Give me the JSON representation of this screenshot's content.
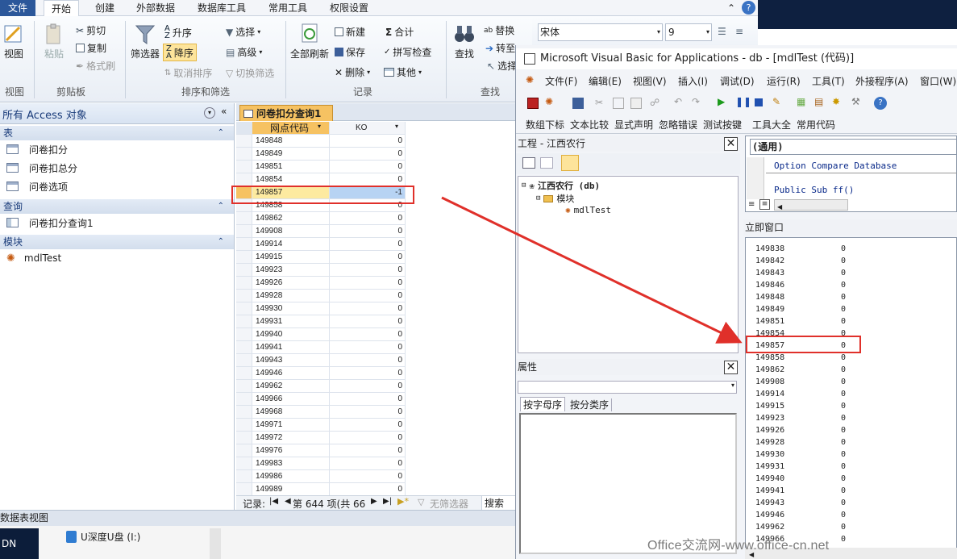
{
  "ribbon_tabs": [
    "文件",
    "开始",
    "创建",
    "外部数据",
    "数据库工具",
    "常用工具",
    "权限设置"
  ],
  "ribbon": {
    "view": "视图",
    "paste": "粘贴",
    "cut": "剪切",
    "copy": "复制",
    "format_painter": "格式刷",
    "filter": "筛选器",
    "asc": "升序",
    "desc": "降序",
    "clear_sort": "取消排序",
    "selection": "选择",
    "advanced": "高级",
    "toggle_filter": "切换筛选",
    "refresh_all": "全部刷新",
    "new": "新建",
    "save": "保存",
    "delete": "删除",
    "totals": "合计",
    "spelling": "拼写检查",
    "more": "其他",
    "find": "查找",
    "replace": "替换",
    "goto": "转至",
    "select": "选择",
    "groups": [
      "视图",
      "剪贴板",
      "排序和筛选",
      "记录",
      "查找"
    ]
  },
  "font": {
    "name": "宋体",
    "size": "9"
  },
  "nav": {
    "title": "所有 Access 对象",
    "tables_hdr": "表",
    "tables": [
      "问卷扣分",
      "问卷扣总分",
      "问卷选项"
    ],
    "queries_hdr": "查询",
    "queries": [
      "问卷扣分查询1"
    ],
    "modules_hdr": "模块",
    "modules": [
      "mdlTest"
    ]
  },
  "datasheet": {
    "tab": "问卷扣分查询1",
    "col1": "网点代码",
    "col2": "KO",
    "rows": [
      [
        "149848",
        "0"
      ],
      [
        "149849",
        "0"
      ],
      [
        "149851",
        "0"
      ],
      [
        "149854",
        "0"
      ],
      [
        "149857",
        "-1"
      ],
      [
        "149858",
        "0"
      ],
      [
        "149862",
        "0"
      ],
      [
        "149908",
        "0"
      ],
      [
        "149914",
        "0"
      ],
      [
        "149915",
        "0"
      ],
      [
        "149923",
        "0"
      ],
      [
        "149926",
        "0"
      ],
      [
        "149928",
        "0"
      ],
      [
        "149930",
        "0"
      ],
      [
        "149931",
        "0"
      ],
      [
        "149940",
        "0"
      ],
      [
        "149941",
        "0"
      ],
      [
        "149943",
        "0"
      ],
      [
        "149946",
        "0"
      ],
      [
        "149962",
        "0"
      ],
      [
        "149966",
        "0"
      ],
      [
        "149968",
        "0"
      ],
      [
        "149971",
        "0"
      ],
      [
        "149972",
        "0"
      ],
      [
        "149976",
        "0"
      ],
      [
        "149983",
        "0"
      ],
      [
        "149986",
        "0"
      ],
      [
        "149989",
        "0"
      ]
    ],
    "selected_index": 4,
    "record_label": "记录:",
    "record_pos": "第 644 项(共 66",
    "no_filter": "无筛选器",
    "search": "搜索"
  },
  "status": {
    "text": "数据表视图"
  },
  "taskbar": {
    "left": "DN",
    "drive": "U深度U盘 (I:)"
  },
  "vba": {
    "title": "Microsoft Visual Basic for Applications - db - [mdlTest (代码)]",
    "menus": [
      "文件(F)",
      "编辑(E)",
      "视图(V)",
      "插入(I)",
      "调试(D)",
      "运行(R)",
      "工具(T)",
      "外接程序(A)",
      "窗口(W)"
    ],
    "toolbar2": [
      "数组下标",
      "文本比较",
      "显式声明",
      "忽略错误",
      "测试按键",
      "工具大全",
      "常用代码"
    ],
    "project_title": "工程 - 江西农行",
    "project_root": "江西农行 (db)",
    "project_folder": "模块",
    "project_module": "mdlTest",
    "props_title": "属性",
    "props_tabs": [
      "按字母序",
      "按分类序"
    ],
    "code_combo": "(通用)",
    "code_lines": [
      "Option Compare Database",
      "Public Sub ff()"
    ],
    "immediate_title": "立即窗口",
    "immediate": [
      [
        "149838",
        "0"
      ],
      [
        "149842",
        "0"
      ],
      [
        "149843",
        "0"
      ],
      [
        "149846",
        "0"
      ],
      [
        "149848",
        "0"
      ],
      [
        "149849",
        "0"
      ],
      [
        "149851",
        "0"
      ],
      [
        "149854",
        "0"
      ],
      [
        "149857",
        "0"
      ],
      [
        "149858",
        "0"
      ],
      [
        "149862",
        "0"
      ],
      [
        "149908",
        "0"
      ],
      [
        "149914",
        "0"
      ],
      [
        "149915",
        "0"
      ],
      [
        "149923",
        "0"
      ],
      [
        "149926",
        "0"
      ],
      [
        "149928",
        "0"
      ],
      [
        "149930",
        "0"
      ],
      [
        "149931",
        "0"
      ],
      [
        "149940",
        "0"
      ],
      [
        "149941",
        "0"
      ],
      [
        "149943",
        "0"
      ],
      [
        "149946",
        "0"
      ],
      [
        "149962",
        "0"
      ],
      [
        "149966",
        "0"
      ]
    ]
  },
  "watermark": "Office交流网-www.office-cn.net",
  "colors": {
    "highlight": "#e0302a",
    "accent": "#2b579a",
    "selection": "#b7d3f3",
    "tab_orange": "#f6c262"
  }
}
